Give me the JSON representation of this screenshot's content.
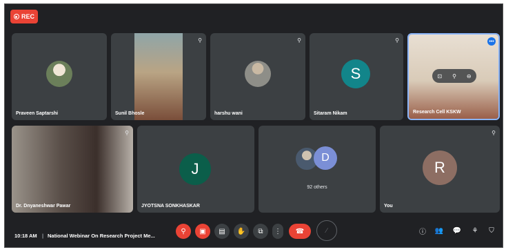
{
  "rec_label": "REC",
  "tiles": {
    "praveen": {
      "name": "Praveen Saptarshi"
    },
    "sunil": {
      "name": "Sunil Bhosle"
    },
    "harshu": {
      "name": "harshu wani"
    },
    "sitaram": {
      "name": "Sitaram Nikam",
      "initial": "S"
    },
    "research": {
      "name": "Research Cell KSKW"
    },
    "dnyaneshwar": {
      "name": "Dr. Dnyaneshwar Pawar"
    },
    "jyotsna": {
      "name": "JYOTSNA SONKHASKAR",
      "initial": "J"
    },
    "others": {
      "initial": "D",
      "count_label": "92 others"
    },
    "you": {
      "name": "You",
      "initial": "R"
    }
  },
  "bottom_bar": {
    "time": "10:18 AM",
    "separator": "|",
    "meeting_title": "National Webinar On Research Project Me..."
  },
  "colors": {
    "background": "#202124",
    "tile": "#3c4043",
    "red": "#ea4335",
    "sitaram_avatar": "#12858a",
    "jyotsna_avatar": "#0b5e4a",
    "you_avatar": "#8d6e63",
    "others_avatar": "#7b8fd6"
  }
}
